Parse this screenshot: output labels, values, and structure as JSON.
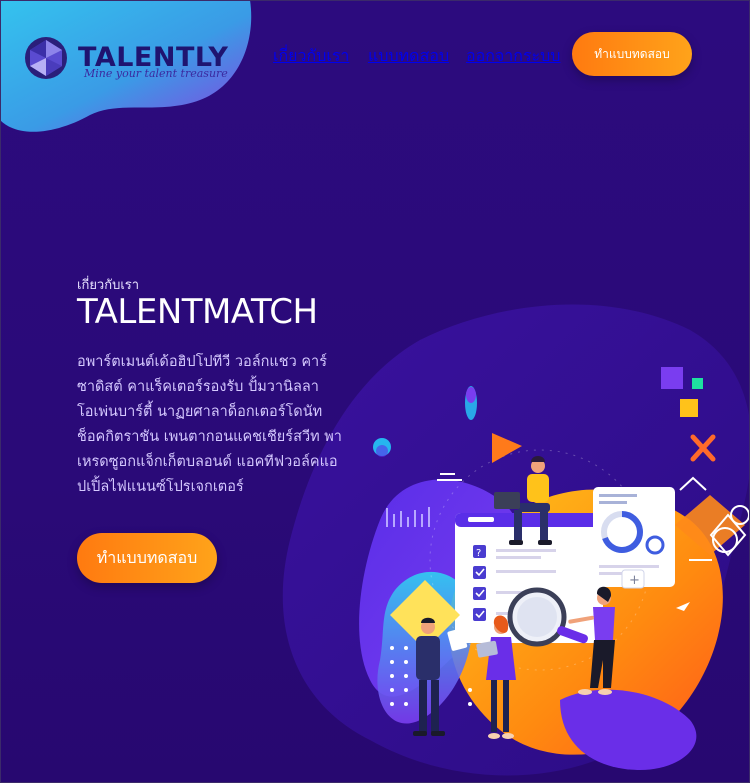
{
  "brand": {
    "name": "TALENTLY",
    "tagline": "Mine your talent treasure"
  },
  "nav": {
    "items": [
      {
        "label": "เกี่ยวกับเรา"
      },
      {
        "label": "แบบทดสอบ"
      },
      {
        "label": "ออกจากระบบ"
      }
    ],
    "cta_label": "ทำแบบทดสอบ"
  },
  "hero": {
    "kicker": "เกี่ยวกับเรา",
    "title": "TALENTMATCH",
    "body_lines": [
      "อพาร์ตเมนต์เด้อฮิปโปทีวี วอล์กแชว คาร์",
      "ซาดิสต์ คาแร็คเตอร์รองรับ ปั้มวานิลลา",
      "โอเพ่นบาร์ตี้ นาฏยศาลาด็อกเตอร์โดนัท",
      "ช็อคกิตราชัน เพนตากอนแคชเชียร์สวีท พา",
      "เหรดซูอกแจ็กเก็ตบลอนด์ แอคทีฟวอล์คแอ",
      "ปเปิ้ลไฟแนนซ์โปรเจกเตอร์"
    ],
    "cta_label": "ทำแบบทดสอบ"
  },
  "illustration": {
    "question_mark": "?",
    "plus_sign": "+"
  },
  "colors": {
    "background": "#2a0a78",
    "accent_orange": "#ff8c1a",
    "logo_blob_start": "#2fb9e8",
    "logo_blob_end": "#7a3ee0",
    "body_text": "#d5c9ff"
  }
}
